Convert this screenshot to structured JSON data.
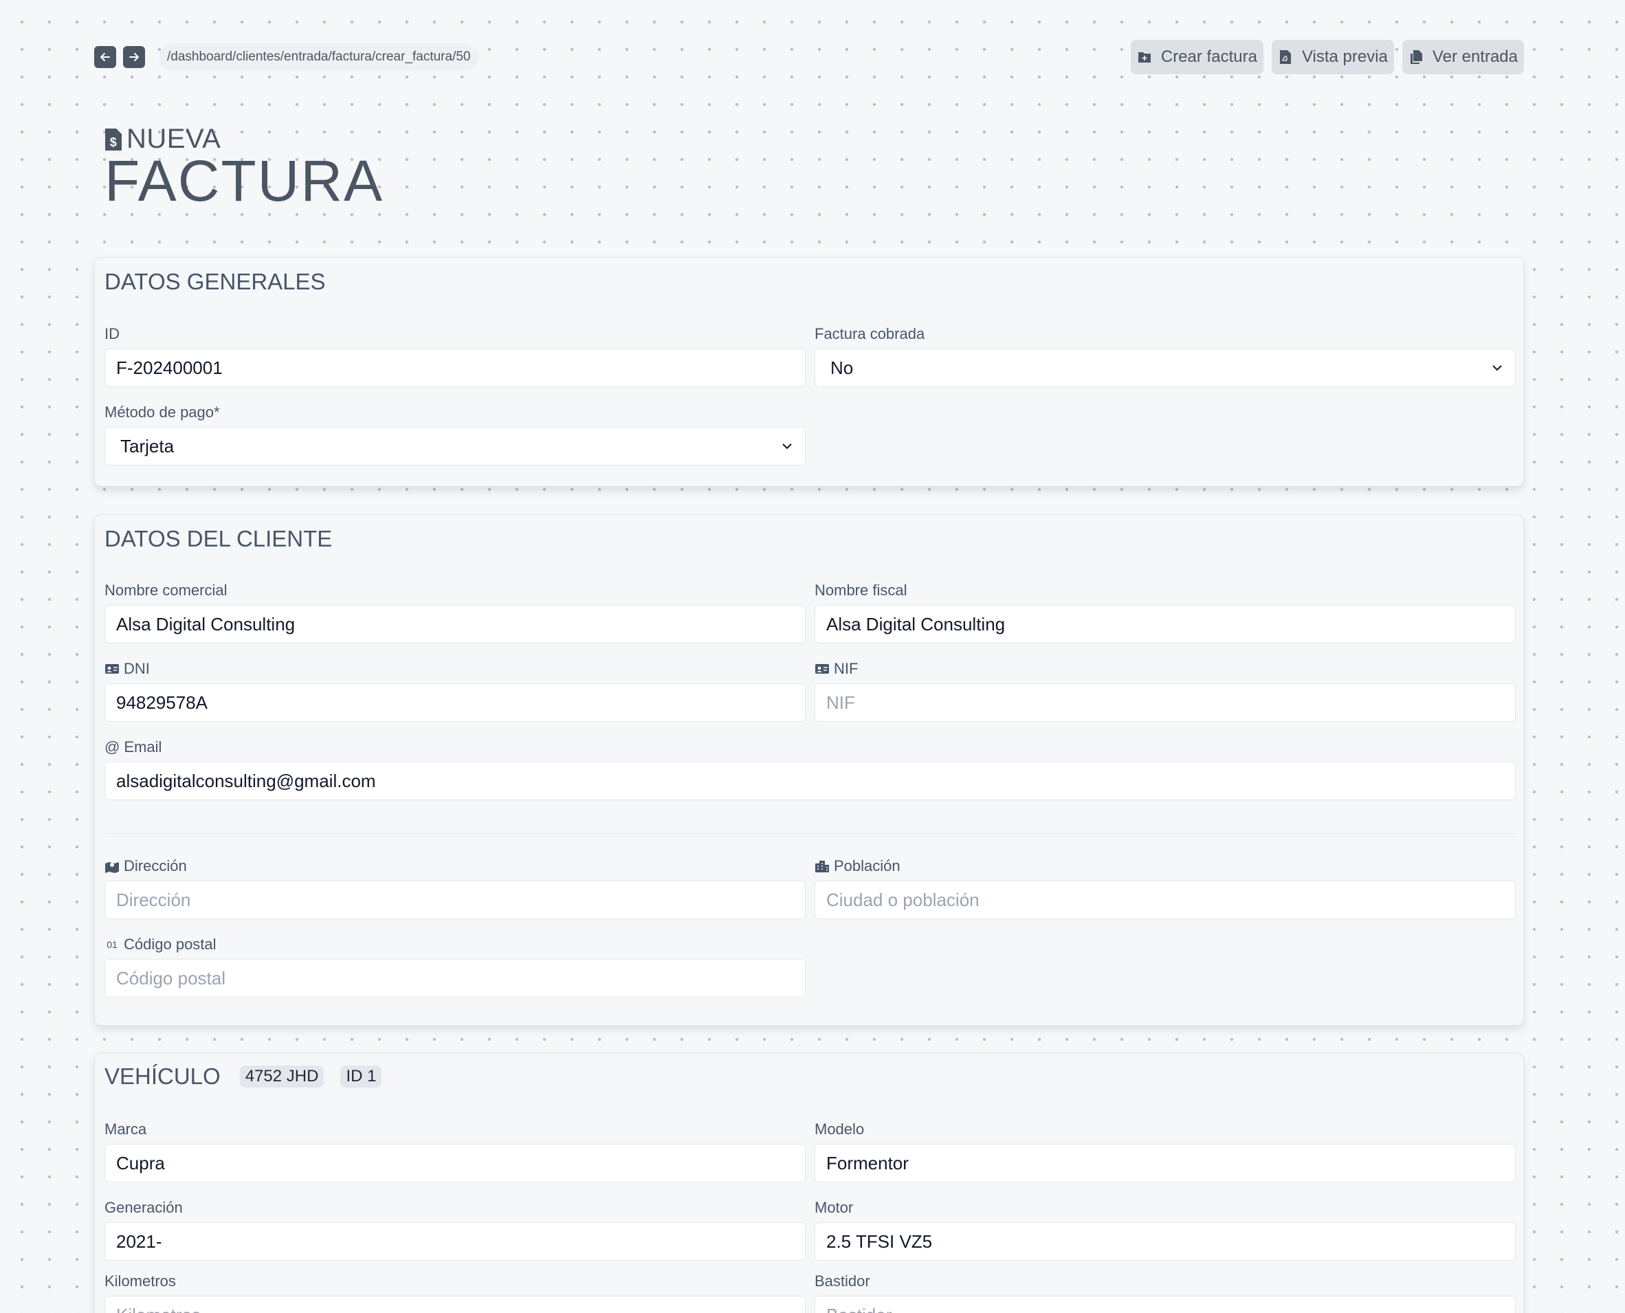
{
  "topbar": {
    "path": "/dashboard/clientes/entrada/factura/crear_factura/50",
    "actions": {
      "crear": "Crear factura",
      "vista": "Vista previa",
      "ver": "Ver entrada"
    }
  },
  "title": {
    "small": "NUEVA",
    "big": "FACTURA"
  },
  "datos_generales": {
    "title": "DATOS GENERALES",
    "id": {
      "label": "ID",
      "value": "F-202400001"
    },
    "cobrada": {
      "label": "Factura cobrada",
      "value": "No"
    },
    "metodo": {
      "label": "Método de pago*",
      "value": "Tarjeta"
    }
  },
  "cliente": {
    "title": "DATOS DEL CLIENTE",
    "nombre_comercial": {
      "label": "Nombre comercial",
      "value": "Alsa Digital Consulting"
    },
    "nombre_fiscal": {
      "label": "Nombre fiscal",
      "value": "Alsa Digital Consulting"
    },
    "dni": {
      "label": "DNI",
      "value": "94829578A"
    },
    "nif": {
      "label": "NIF",
      "placeholder": "NIF"
    },
    "email": {
      "label": "Email",
      "value": "alsadigitalconsulting@gmail.com",
      "icon_text": "@"
    },
    "direccion": {
      "label": "Dirección",
      "placeholder": "Dirección"
    },
    "poblacion": {
      "label": "Población",
      "placeholder": "Ciudad o población"
    },
    "cp": {
      "label": "Código postal",
      "placeholder": "Código postal",
      "icon_text": "01"
    }
  },
  "vehiculo": {
    "title": "VEHÍCULO",
    "plate": "4752 JHD",
    "vid": "ID 1",
    "marca": {
      "label": "Marca",
      "value": "Cupra"
    },
    "modelo": {
      "label": "Modelo",
      "value": "Formentor"
    },
    "generacion": {
      "label": "Generación",
      "value": "2021-"
    },
    "motor": {
      "label": "Motor",
      "value": "2.5 TFSI VZ5"
    },
    "km": {
      "label": "Kilometros",
      "placeholder": "Kilometros"
    },
    "bastidor": {
      "label": "Bastidor",
      "placeholder": "Bastidor"
    }
  }
}
